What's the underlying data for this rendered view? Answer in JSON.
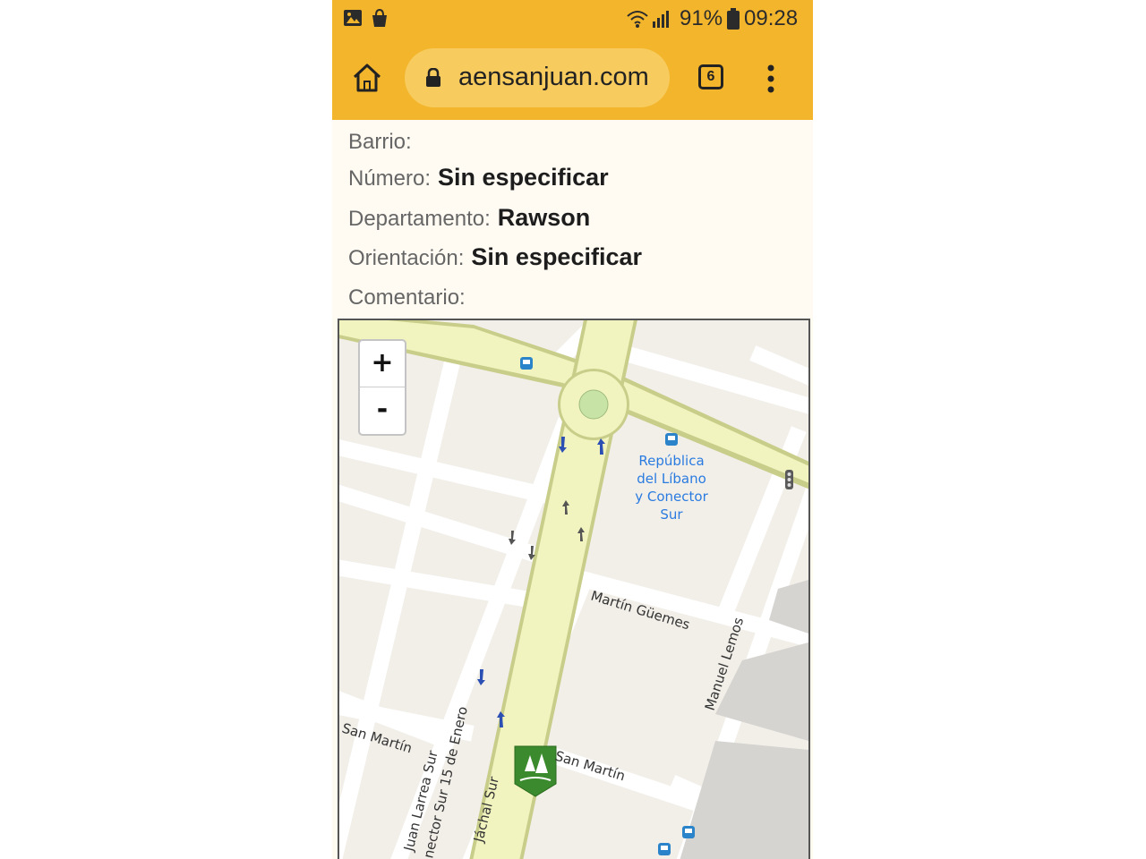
{
  "status_bar": {
    "battery_percent": "91%",
    "time": "09:28",
    "icons": [
      "gallery-icon",
      "shopping-bag-icon",
      "wifi-icon",
      "signal-icon",
      "battery-icon"
    ]
  },
  "browser": {
    "url": "aensanjuan.com",
    "tab_count": "6",
    "icons": [
      "home-icon",
      "lock-icon",
      "tabs-icon",
      "menu-kebab-icon"
    ]
  },
  "details": {
    "barrio": {
      "label": "Barrio:",
      "value": ""
    },
    "numero": {
      "label": "Número:",
      "value": "Sin especificar"
    },
    "departamento": {
      "label": "Departamento:",
      "value": "Rawson"
    },
    "orientacion": {
      "label": "Orientación:",
      "value": "Sin especificar"
    },
    "comentario": {
      "label": "Comentario:",
      "value": ""
    }
  },
  "map": {
    "zoom_in": "+",
    "zoom_out": "-",
    "poi_label": [
      "República",
      "del Líbano",
      "y Conector",
      "Sur"
    ],
    "streets": {
      "martin_guemes": "Martín Güemes",
      "manuel_lemos": "Manuel Lemos",
      "san_martin_left": "San Martín",
      "san_martin_right": "San Martín",
      "juan_larrea": "Juan Larrea Sur",
      "conector": "nector Sur 15 de Enero",
      "jachal": "Jáchal Sur"
    },
    "colors": {
      "main_road": "#f2f4bf",
      "road_edge": "#c9cd8a",
      "block": "#e8e4dd",
      "building": "#d6d4d0",
      "poi_text": "#2a7be0"
    }
  }
}
